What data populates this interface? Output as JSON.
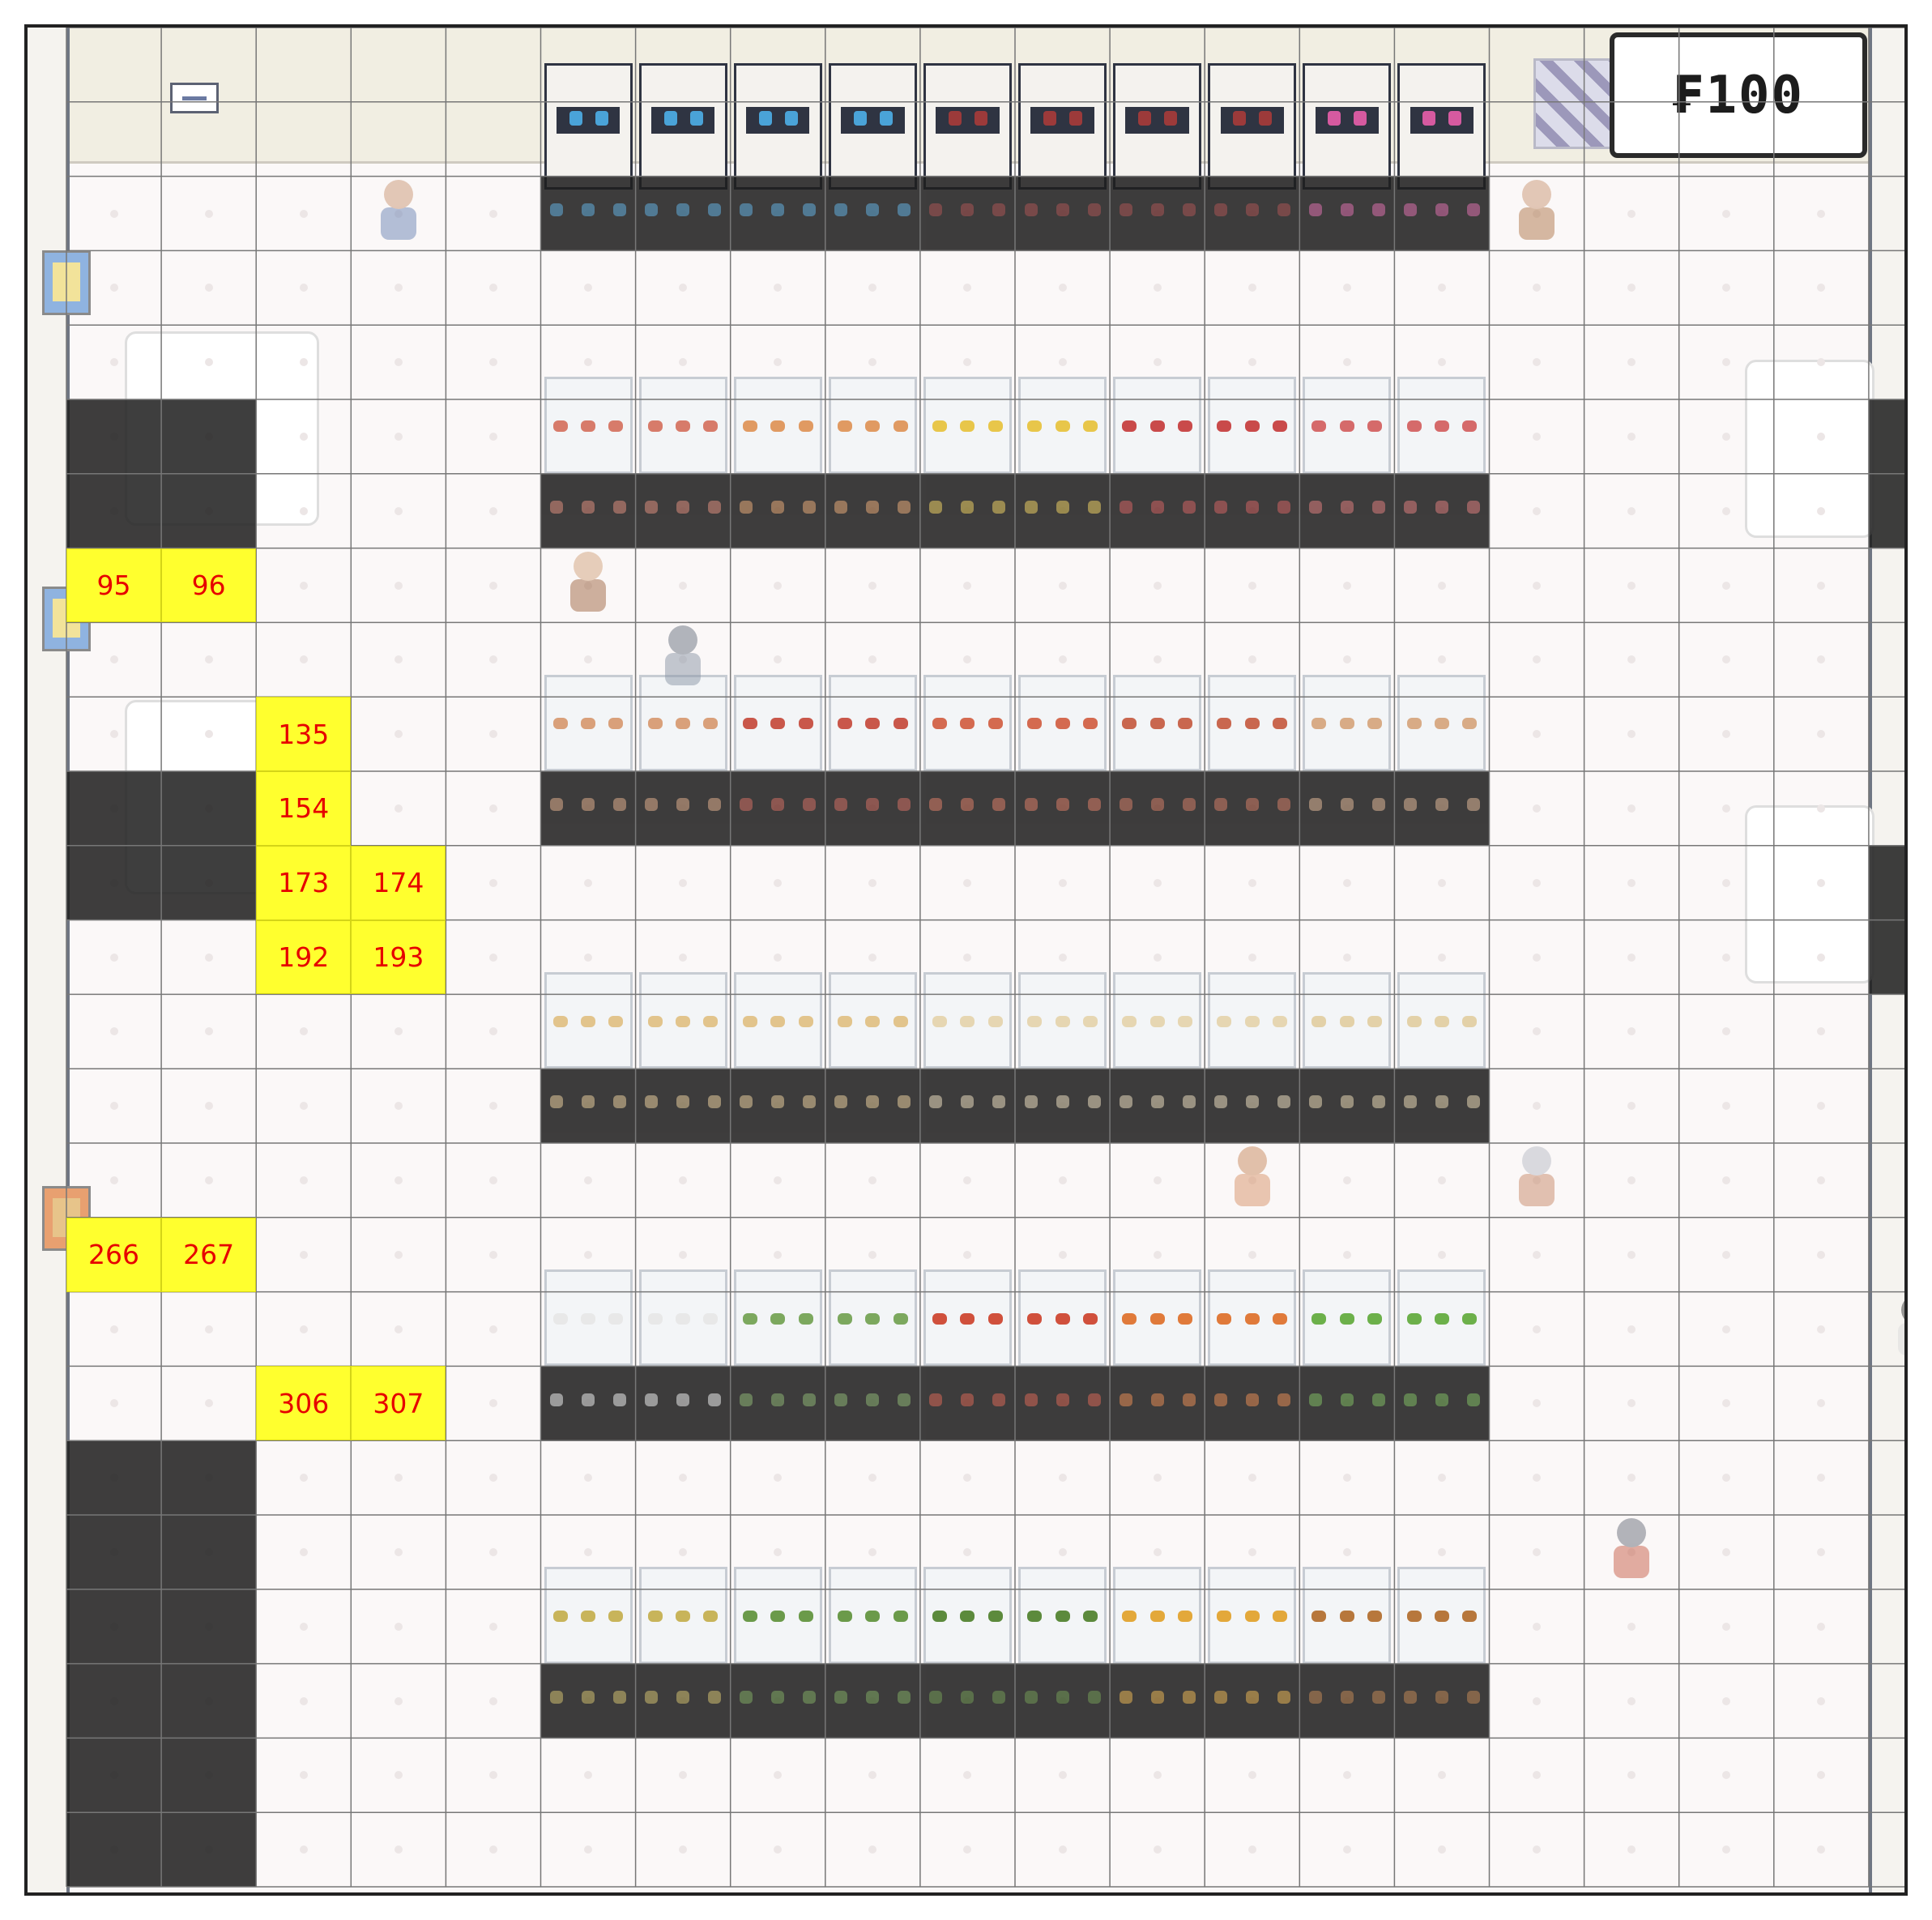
{
  "hud": {
    "money_label": "₣100"
  },
  "colors": {
    "highlight": "#ffff2e",
    "label": "#e60000",
    "blocked": "#1e1e1e",
    "grid_line": "#777777"
  },
  "board": {
    "cols": 20,
    "rows": 25,
    "highlighted_cells": [
      {
        "id": "95",
        "col": 0,
        "row": 7
      },
      {
        "id": "96",
        "col": 1,
        "row": 7
      },
      {
        "id": "135",
        "col": 2,
        "row": 9
      },
      {
        "id": "154",
        "col": 2,
        "row": 10
      },
      {
        "id": "173",
        "col": 2,
        "row": 11
      },
      {
        "id": "174",
        "col": 3,
        "row": 11
      },
      {
        "id": "192",
        "col": 2,
        "row": 12
      },
      {
        "id": "193",
        "col": 3,
        "row": 12
      },
      {
        "id": "266",
        "col": 0,
        "row": 16
      },
      {
        "id": "267",
        "col": 1,
        "row": 16
      },
      {
        "id": "306",
        "col": 2,
        "row": 18
      },
      {
        "id": "307",
        "col": 3,
        "row": 18
      }
    ],
    "blocked_cells": [
      {
        "col": 5,
        "row": 2
      },
      {
        "col": 6,
        "row": 2
      },
      {
        "col": 7,
        "row": 2
      },
      {
        "col": 8,
        "row": 2
      },
      {
        "col": 9,
        "row": 2
      },
      {
        "col": 10,
        "row": 2
      },
      {
        "col": 11,
        "row": 2
      },
      {
        "col": 12,
        "row": 2
      },
      {
        "col": 13,
        "row": 2
      },
      {
        "col": 14,
        "row": 2
      },
      {
        "col": 0,
        "row": 5
      },
      {
        "col": 1,
        "row": 5
      },
      {
        "col": 0,
        "row": 6
      },
      {
        "col": 1,
        "row": 6
      },
      {
        "col": 19,
        "row": 5
      },
      {
        "col": 19,
        "row": 6
      },
      {
        "col": 5,
        "row": 6
      },
      {
        "col": 6,
        "row": 6
      },
      {
        "col": 7,
        "row": 6
      },
      {
        "col": 8,
        "row": 6
      },
      {
        "col": 9,
        "row": 6
      },
      {
        "col": 10,
        "row": 6
      },
      {
        "col": 11,
        "row": 6
      },
      {
        "col": 12,
        "row": 6
      },
      {
        "col": 13,
        "row": 6
      },
      {
        "col": 14,
        "row": 6
      },
      {
        "col": 0,
        "row": 10
      },
      {
        "col": 1,
        "row": 10
      },
      {
        "col": 0,
        "row": 11
      },
      {
        "col": 1,
        "row": 11
      },
      {
        "col": 5,
        "row": 10
      },
      {
        "col": 6,
        "row": 10
      },
      {
        "col": 7,
        "row": 10
      },
      {
        "col": 8,
        "row": 10
      },
      {
        "col": 9,
        "row": 10
      },
      {
        "col": 10,
        "row": 10
      },
      {
        "col": 11,
        "row": 10
      },
      {
        "col": 12,
        "row": 10
      },
      {
        "col": 13,
        "row": 10
      },
      {
        "col": 14,
        "row": 10
      },
      {
        "col": 19,
        "row": 11
      },
      {
        "col": 19,
        "row": 12
      },
      {
        "col": 5,
        "row": 14
      },
      {
        "col": 6,
        "row": 14
      },
      {
        "col": 7,
        "row": 14
      },
      {
        "col": 8,
        "row": 14
      },
      {
        "col": 9,
        "row": 14
      },
      {
        "col": 10,
        "row": 14
      },
      {
        "col": 11,
        "row": 14
      },
      {
        "col": 12,
        "row": 14
      },
      {
        "col": 13,
        "row": 14
      },
      {
        "col": 14,
        "row": 14
      },
      {
        "col": 5,
        "row": 18
      },
      {
        "col": 6,
        "row": 18
      },
      {
        "col": 7,
        "row": 18
      },
      {
        "col": 8,
        "row": 18
      },
      {
        "col": 9,
        "row": 18
      },
      {
        "col": 10,
        "row": 18
      },
      {
        "col": 11,
        "row": 18
      },
      {
        "col": 12,
        "row": 18
      },
      {
        "col": 13,
        "row": 18
      },
      {
        "col": 14,
        "row": 18
      },
      {
        "col": 0,
        "row": 19
      },
      {
        "col": 1,
        "row": 19
      },
      {
        "col": 0,
        "row": 20
      },
      {
        "col": 1,
        "row": 20
      },
      {
        "col": 0,
        "row": 21
      },
      {
        "col": 1,
        "row": 21
      },
      {
        "col": 0,
        "row": 22
      },
      {
        "col": 1,
        "row": 22
      },
      {
        "col": 0,
        "row": 23
      },
      {
        "col": 1,
        "row": 23
      },
      {
        "col": 0,
        "row": 24
      },
      {
        "col": 1,
        "row": 24
      },
      {
        "col": 5,
        "row": 22
      },
      {
        "col": 6,
        "row": 22
      },
      {
        "col": 7,
        "row": 22
      },
      {
        "col": 8,
        "row": 22
      },
      {
        "col": 9,
        "row": 22
      },
      {
        "col": 10,
        "row": 22
      },
      {
        "col": 11,
        "row": 22
      },
      {
        "col": 12,
        "row": 22
      },
      {
        "col": 13,
        "row": 22
      },
      {
        "col": 14,
        "row": 22
      }
    ]
  },
  "shelf_rows": [
    {
      "name": "drinks-fridge-row",
      "row": 0,
      "item_colors": [
        "#4aa3d8",
        "#4aa3d8",
        "#4aa3d8",
        "#4aa3d8",
        "#9c3a3a",
        "#9c3a3a",
        "#9c3a3a",
        "#9c3a3a",
        "#d65aa0",
        "#d65aa0"
      ]
    },
    {
      "name": "produce-shelf-row-1",
      "row": 5,
      "item_colors": [
        "#d77b6a",
        "#d77b6a",
        "#e09a62",
        "#e09a62",
        "#e8c64a",
        "#e8c64a",
        "#c94a4a",
        "#c94a4a",
        "#d56a6a",
        "#d56a6a"
      ]
    },
    {
      "name": "meat-shelf-row",
      "row": 9,
      "item_colors": [
        "#d9a07a",
        "#d9a07a",
        "#c9574a",
        "#c9574a",
        "#d46a50",
        "#d46a50",
        "#c9674f",
        "#c9674f",
        "#d8ab86",
        "#d8ab86"
      ]
    },
    {
      "name": "bakery-shelf-row",
      "row": 13,
      "item_colors": [
        "#e2c48c",
        "#e2c48c",
        "#e2c48c",
        "#e2c48c",
        "#e6d6b2",
        "#e6d6b2",
        "#e6d6b2",
        "#e6d6b2",
        "#e3d1a8",
        "#e3d1a8"
      ]
    },
    {
      "name": "vegetable-shelf-row",
      "row": 17,
      "item_colors": [
        "#e8e8e8",
        "#e8e8e8",
        "#7ca85e",
        "#7ca85e",
        "#d0503c",
        "#d0503c",
        "#e07a3a",
        "#e07a3a",
        "#6cb04a",
        "#6cb04a"
      ]
    },
    {
      "name": "fruit-shelf-row",
      "row": 21,
      "item_colors": [
        "#c8b45a",
        "#c8b45a",
        "#6b9a4a",
        "#6b9a4a",
        "#5c8a3c",
        "#5c8a3c",
        "#e3a83a",
        "#e3a83a",
        "#b7773c",
        "#b7773c"
      ]
    }
  ],
  "shoppers": [
    {
      "name": "shopper-blue-top-left",
      "col": 3,
      "row": 2,
      "head": "#c99674",
      "body": "#6d85b5"
    },
    {
      "name": "shopper-brown-top-right",
      "col": 15,
      "row": 2,
      "head": "#c99674",
      "body": "#b0784c"
    },
    {
      "name": "shopper-tan-left",
      "col": 5,
      "row": 7,
      "head": "#d2a47e",
      "body": "#a06844"
    },
    {
      "name": "shopper-grey-aisle",
      "col": 6,
      "row": 8,
      "head": "#6a7380",
      "body": "#8a96a6"
    },
    {
      "name": "shopper-orange-middle",
      "col": 12,
      "row": 15,
      "head": "#c98a5e",
      "body": "#d9946a"
    },
    {
      "name": "shopper-grey-hair",
      "col": 15,
      "row": 15,
      "head": "#b8bcc6",
      "body": "#c88a6a"
    },
    {
      "name": "shopper-right-wall",
      "col": 19,
      "row": 17,
      "head": "#3a3a3a",
      "body": "#dcdcdc"
    },
    {
      "name": "shopper-bottom-right",
      "col": 16,
      "row": 20,
      "head": "#6a6e7a",
      "body": "#c8604a"
    }
  ]
}
